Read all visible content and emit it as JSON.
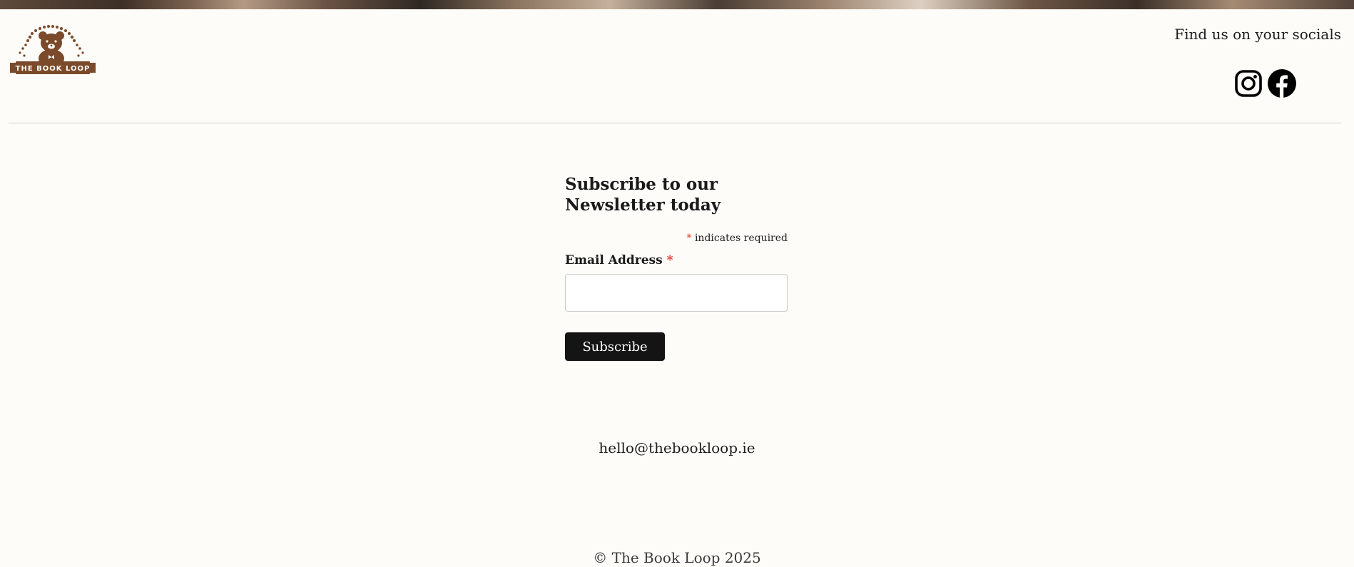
{
  "brand": {
    "logo_text": "THE BOOK LOOP",
    "logo_color": "#7a4a2a"
  },
  "socials": {
    "heading": "Find us on your socials",
    "links": [
      {
        "name": "instagram",
        "icon": "instagram-icon"
      },
      {
        "name": "facebook",
        "icon": "facebook-icon"
      }
    ]
  },
  "newsletter": {
    "title": "Subscribe to our Newsletter today",
    "required_marker": "*",
    "required_note": "indicates required",
    "email_label": "Email Address",
    "email_value": "",
    "subscribe_label": "Subscribe",
    "button_color": "#141414",
    "required_color": "#e0392b"
  },
  "footer": {
    "email": "hello@thebookloop.ie",
    "copyright_symbol": "©",
    "copyright_text": "The Book Loop 2025"
  }
}
